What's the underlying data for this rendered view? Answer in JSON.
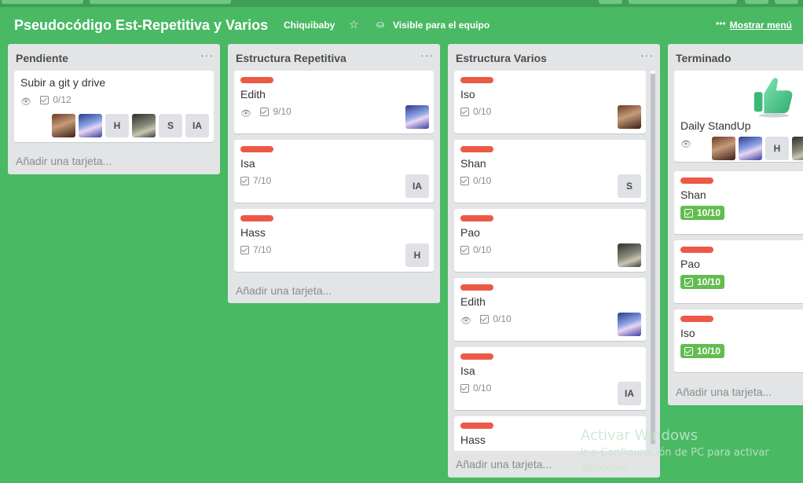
{
  "board": {
    "title": "Pseudocódigo Est-Repetitiva y Varios",
    "team": "Chiquibaby",
    "visibility": "Visible para el equipo",
    "menu": "Mostrar menú"
  },
  "add_card_label": "Añadir una tarjeta...",
  "lists": [
    {
      "title": "Pendiente",
      "cards": [
        {
          "title": "Subir a git y drive",
          "watch": true,
          "checklist": "0/12",
          "members": [
            "avatar-brown",
            "avatar-blue",
            "H",
            "avatar-gray",
            "S",
            "IA"
          ]
        }
      ]
    },
    {
      "title": "Estructura Repetitiva",
      "cards": [
        {
          "title": "Edith",
          "label": "red",
          "watch": true,
          "checklist": "9/10",
          "members": [
            "avatar-blue"
          ]
        },
        {
          "title": "Isa",
          "label": "red",
          "checklist": "7/10",
          "members": [
            "IA"
          ]
        },
        {
          "title": "Hass",
          "label": "red",
          "checklist": "7/10",
          "members": [
            "H"
          ]
        }
      ]
    },
    {
      "title": "Estructura Varios",
      "cards": [
        {
          "title": "Iso",
          "label": "red",
          "checklist": "0/10",
          "members": [
            "avatar-brown"
          ]
        },
        {
          "title": "Shan",
          "label": "red",
          "checklist": "0/10",
          "members": [
            "S"
          ]
        },
        {
          "title": "Pao",
          "label": "red",
          "checklist": "0/10",
          "members": [
            "avatar-gray"
          ]
        },
        {
          "title": "Edith",
          "label": "red",
          "watch": true,
          "checklist": "0/10",
          "members": [
            "avatar-blue"
          ]
        },
        {
          "title": "Isa",
          "label": "red",
          "checklist": "0/10",
          "members": [
            "IA"
          ]
        },
        {
          "title": "Hass",
          "label": "red"
        }
      ]
    },
    {
      "title": "Terminado",
      "cards": [
        {
          "title": "Daily StandUp",
          "cover": "thumbs-up-icon",
          "watch": true,
          "members": [
            "avatar-brown",
            "avatar-blue",
            "H",
            "avatar-gray"
          ]
        },
        {
          "title": "Shan",
          "label": "red",
          "checklist": "10/10",
          "complete": true
        },
        {
          "title": "Pao",
          "label": "red",
          "checklist": "10/10",
          "complete": true
        },
        {
          "title": "Iso",
          "label": "red",
          "checklist": "10/10",
          "complete": true
        }
      ]
    }
  ],
  "watermark": {
    "line1": "Activar Windows",
    "line2": "Ir a Configuración de PC para activar Windows."
  },
  "colors": {
    "board_bg": "#49b964",
    "list_bg": "#e2e4e6",
    "label_red": "#eb5a46",
    "complete_green": "#61bd4f"
  },
  "icons": [
    "star-icon",
    "team-icon",
    "more-icon",
    "eye-icon",
    "checklist-icon",
    "thumbs-up-icon"
  ]
}
